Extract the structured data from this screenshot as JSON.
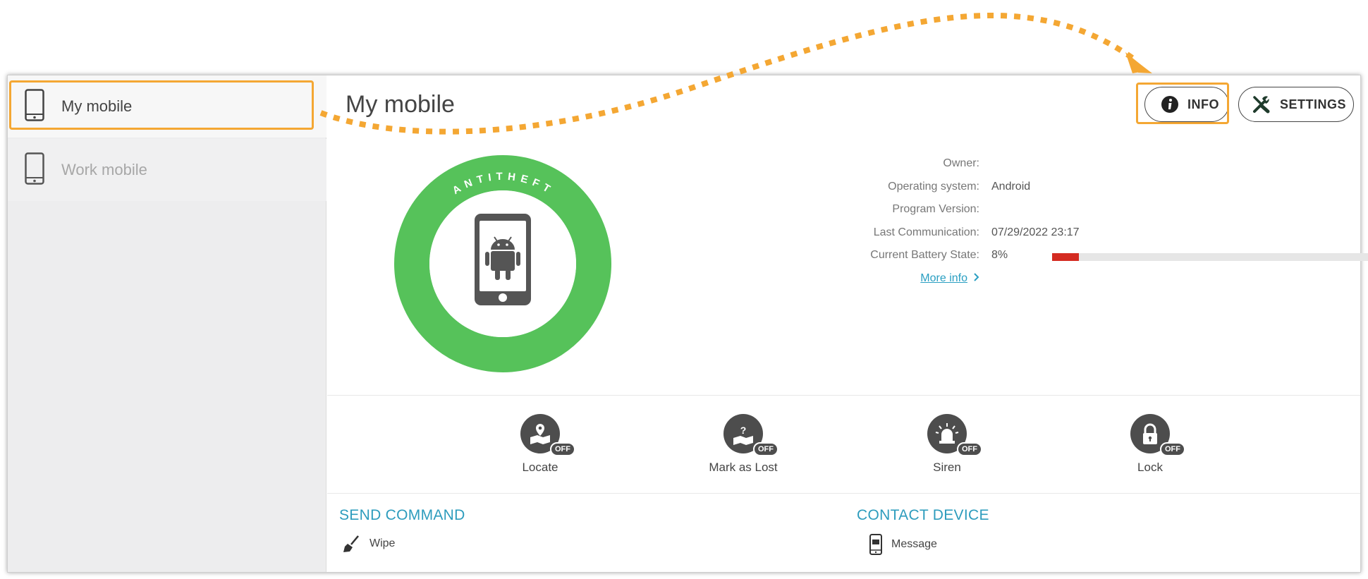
{
  "sidebar": {
    "devices": [
      {
        "label": "My mobile",
        "state": "active"
      },
      {
        "label": "Work mobile",
        "state": "inactive"
      }
    ]
  },
  "header": {
    "title": "My mobile",
    "info_label": "INFO",
    "settings_label": "SETTINGS"
  },
  "badge": {
    "ring_text": "ANTITHEFT",
    "ring_color": "#56c25a",
    "icon": "android-phone-icon"
  },
  "device_info": {
    "owner_label": "Owner:",
    "owner_value": "",
    "os_label": "Operating system:",
    "os_value": "Android",
    "version_label": "Program Version:",
    "version_value": "",
    "last_comm_label": "Last Communication:",
    "last_comm_value": "07/29/2022 23:17",
    "battery_label": "Current Battery State:",
    "battery_value": "8%",
    "battery_level": 0.08,
    "more_info_label": "More info"
  },
  "actions": [
    {
      "label": "Locate",
      "status": "OFF",
      "icon": "locate-map-pin-icon"
    },
    {
      "label": "Mark as Lost",
      "status": "OFF",
      "icon": "mark-lost-question-icon"
    },
    {
      "label": "Siren",
      "status": "OFF",
      "icon": "siren-icon"
    },
    {
      "label": "Lock",
      "status": "OFF",
      "icon": "padlock-icon"
    }
  ],
  "send_command": {
    "title": "SEND COMMAND",
    "items": [
      {
        "label": "Wipe",
        "icon": "broom-icon"
      }
    ]
  },
  "contact_device": {
    "title": "CONTACT DEVICE",
    "items": [
      {
        "label": "Message",
        "icon": "phone-message-icon"
      }
    ]
  },
  "colors": {
    "accent": "#2d9cbd",
    "highlight": "#f4a733",
    "battery": "#d42b21"
  }
}
